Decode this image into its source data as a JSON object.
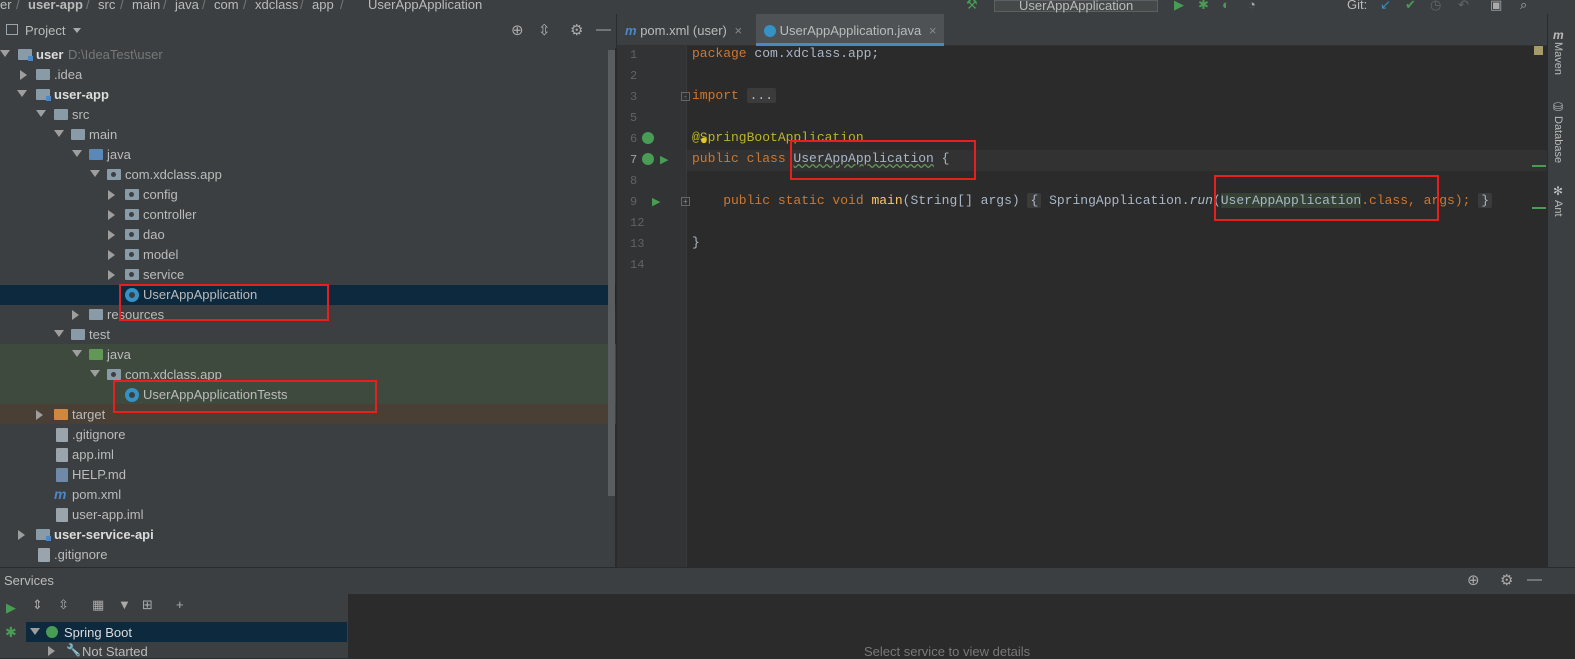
{
  "nav": {
    "crumbs": [
      "er",
      "user-app",
      "src",
      "main",
      "java",
      "com",
      "xdclass",
      "app",
      "UserAppApplication"
    ],
    "run_config": "UserAppApplication",
    "git_label": "Git:"
  },
  "project": {
    "title": "Project",
    "tree": [
      {
        "label": "user",
        "extra": "D:\\IdeaTest\\user"
      },
      {
        "label": ".idea"
      },
      {
        "label": "user-app"
      },
      {
        "label": "src"
      },
      {
        "label": "main"
      },
      {
        "label": "java"
      },
      {
        "label": "com.xdclass.app"
      },
      {
        "label": "config"
      },
      {
        "label": "controller"
      },
      {
        "label": "dao"
      },
      {
        "label": "model"
      },
      {
        "label": "service"
      },
      {
        "label": "UserAppApplication"
      },
      {
        "label": "resources"
      },
      {
        "label": "test"
      },
      {
        "label": "java"
      },
      {
        "label": "com.xdclass.app"
      },
      {
        "label": "UserAppApplicationTests"
      },
      {
        "label": "target"
      },
      {
        "label": ".gitignore"
      },
      {
        "label": "app.iml"
      },
      {
        "label": "HELP.md"
      },
      {
        "label": "pom.xml"
      },
      {
        "label": "user-app.iml"
      },
      {
        "label": "user-service-api"
      },
      {
        "label": ".gitignore"
      }
    ]
  },
  "editor": {
    "tabs": [
      {
        "label": "pom.xml (user)"
      },
      {
        "label": "UserAppApplication.java"
      }
    ],
    "line_numbers": [
      "1",
      "2",
      "3",
      "5",
      "6",
      "7",
      "8",
      "9",
      "12",
      "13",
      "14"
    ],
    "code": {
      "l1_kw": "package",
      "l1_rest": " com.xdclass.app;",
      "l3_kw": "import",
      "l3_fold": "...",
      "l6_ann": "@SpringBootApplication",
      "l7_kw": "public class ",
      "l7_name": "UserAppApplication",
      "l7_rest": " {",
      "l9_kw": "    public static void ",
      "l9_fn": "main",
      "l9_args": "(String[] args) ",
      "l9_fold_open": "{",
      "l9_call": " SpringApplication.",
      "l9_run": "run",
      "l9_paren": "(",
      "l9_cls": "UserAppApplication",
      "l9_dotclass": ".class",
      "l9_tail": ", args); ",
      "l9_fold_close": "}",
      "l13": "}"
    }
  },
  "right_bar": [
    "Maven",
    "Database",
    "Ant"
  ],
  "services": {
    "title": "Services",
    "tree": [
      {
        "label": "Spring Boot"
      },
      {
        "label": "Not Started"
      }
    ],
    "placeholder": "Select service to view details"
  }
}
